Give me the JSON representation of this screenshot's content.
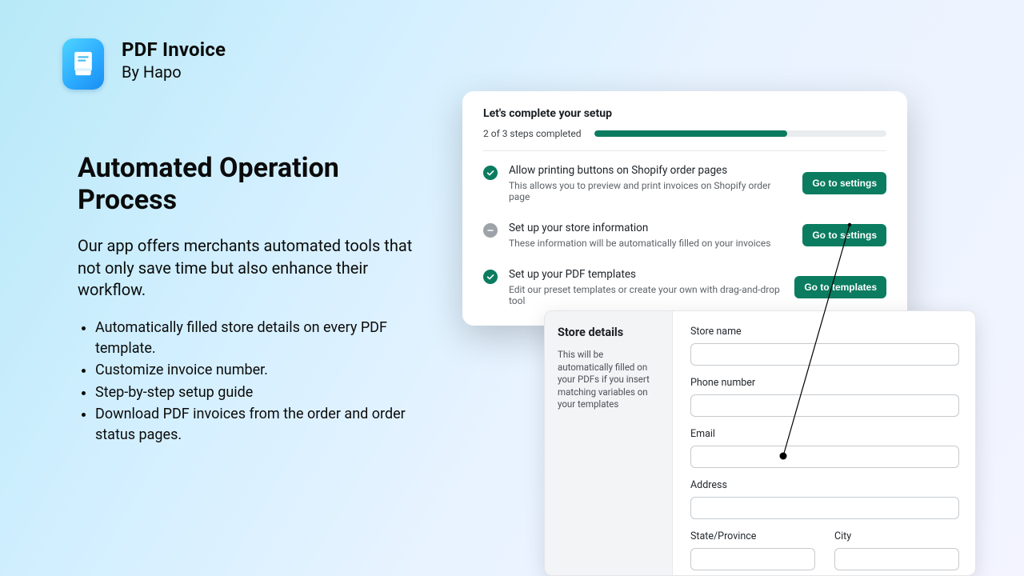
{
  "app": {
    "name": "PDF Invoice",
    "by": "By Hapo"
  },
  "hero": {
    "title": "Automated Operation Process",
    "lead": "Our app offers merchants automated tools that not only save time but also enhance their workflow.",
    "bullets": [
      "Automatically filled store details on every PDF template.",
      "Customize invoice number.",
      "Step-by-step setup guide",
      "Download PDF invoices from the order and order status pages."
    ]
  },
  "setup": {
    "title": "Let's complete your setup",
    "progress_text": "2 of 3 steps completed",
    "progress_percent": 66,
    "tasks": [
      {
        "status": "done",
        "title": "Allow printing buttons on Shopify order pages",
        "sub": "This allows you to preview and print invoices on Shopify order page",
        "cta": "Go to settings"
      },
      {
        "status": "todo",
        "title": "Set up your store information",
        "sub": "These information will be automatically filled on your invoices",
        "cta": "Go to settings"
      },
      {
        "status": "done",
        "title": "Set up your PDF templates",
        "sub": "Edit our preset templates or create your own with drag-and-drop tool",
        "cta": "Go to templates"
      }
    ]
  },
  "details": {
    "title": "Store details",
    "desc": "This will be automatically filled on your PDFs if you insert matching variables on your templates",
    "labels": {
      "store_name": "Store name",
      "phone": "Phone number",
      "email": "Email",
      "address": "Address",
      "state": "State/Province",
      "city": "City"
    }
  }
}
